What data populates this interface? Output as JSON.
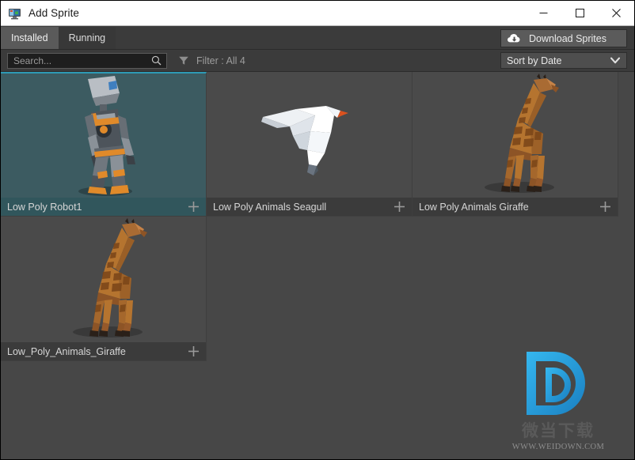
{
  "window": {
    "title": "Add Sprite",
    "icon": "monitor-sprite-icon",
    "controls": {
      "minimize": "minimize-icon",
      "maximize": "maximize-icon",
      "close": "close-icon"
    }
  },
  "tabs": [
    {
      "label": "Installed",
      "active": true
    },
    {
      "label": "Running",
      "active": false
    }
  ],
  "toolbar": {
    "download_label": "Download Sprites",
    "download_icon": "cloud-download-icon"
  },
  "filterbar": {
    "search_value": "",
    "search_placeholder": "Search...",
    "search_icon": "search-icon",
    "filter_icon": "funnel-icon",
    "filter_label": "Filter : All 4",
    "sort_value": "Sort by Date",
    "sort_caret": "chevron-down-icon"
  },
  "grid": {
    "add_icon": "plus-icon",
    "tiles": [
      {
        "name": "Low Poly Robot1",
        "art": "robot",
        "selected": true
      },
      {
        "name": "Low Poly Animals Seagull",
        "art": "seagull",
        "selected": false
      },
      {
        "name": "Low Poly Animals Giraffe",
        "art": "giraffe",
        "selected": false
      },
      {
        "name": "Low_Poly_Animals_Giraffe",
        "art": "giraffe",
        "selected": false
      }
    ]
  },
  "watermark": {
    "logo": "letter-d-logo",
    "cn_text": "微当下载",
    "url_text": "WWW.WEIDOWN.COM",
    "accent_color": "#29a3dd"
  },
  "colors": {
    "window_bg": "#474747",
    "titlebar_bg": "#ffffff",
    "chrome_bg": "#3b3b3b",
    "tile_bg": "#4a4a4a",
    "tile_selected_bg": "#3c5b61",
    "tile_selected_accent": "#2e9ab5",
    "text": "#d6d6d6"
  }
}
